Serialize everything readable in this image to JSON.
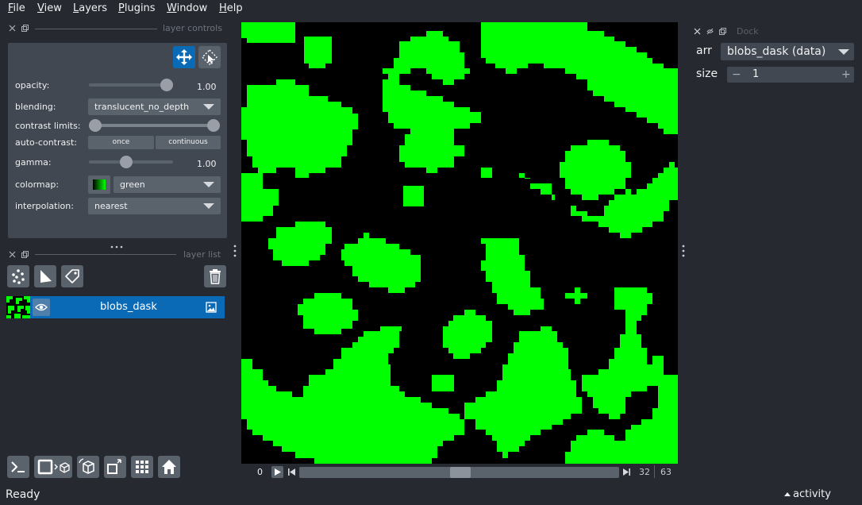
{
  "menubar": {
    "items": [
      {
        "label": "File",
        "mnemonic": "F",
        "rest": "ile"
      },
      {
        "label": "View",
        "mnemonic": "V",
        "rest": "iew"
      },
      {
        "label": "Layers",
        "mnemonic": "L",
        "rest": "ayers"
      },
      {
        "label": "Plugins",
        "mnemonic": "P",
        "rest": "lugins"
      },
      {
        "label": "Window",
        "mnemonic": "W",
        "rest": "indow"
      },
      {
        "label": "Help",
        "mnemonic": "H",
        "rest": "elp"
      }
    ]
  },
  "layer_controls": {
    "title": "layer controls",
    "opacity": {
      "label": "opacity:",
      "value": "1.00",
      "level": 1.0
    },
    "blending": {
      "label": "blending:",
      "value": "translucent_no_depth"
    },
    "contrast_limits": {
      "label": "contrast limits:",
      "min_level": 0.0,
      "max_level": 1.0
    },
    "auto_contrast": {
      "label": "auto-contrast:",
      "once": "once",
      "continuous": "continuous"
    },
    "gamma": {
      "label": "gamma:",
      "value": "1.00",
      "level": 0.5
    },
    "colormap": {
      "label": "colormap:",
      "value": "green"
    },
    "interpolation": {
      "label": "interpolation:",
      "value": "nearest"
    }
  },
  "layer_list": {
    "title": "layer list",
    "layers": [
      {
        "name": "blobs_dask",
        "visible": true,
        "selected": true
      }
    ]
  },
  "dims": {
    "left_value": "0",
    "current": "32",
    "total": "63",
    "position": 0.5
  },
  "dock": {
    "title": "Dock",
    "arr_label": "arr",
    "arr_value": "blobs_dask (data)",
    "size_label": "size",
    "size_value": "1",
    "minus": "−",
    "plus": "+"
  },
  "status": {
    "text": "Ready",
    "activity": "activity"
  },
  "colors": {
    "background": "#262930",
    "panel": "#414851",
    "accent": "#0a6ab5",
    "blob": "#00ff00"
  },
  "icons": {
    "pan_zoom": "move-arrows-icon",
    "transform": "transform-icon",
    "new_points": "points-icon",
    "new_shapes": "shapes-icon",
    "new_labels": "labels-tag-icon",
    "delete": "trash-icon",
    "visibility": "eye-icon",
    "layer_type": "image-icon",
    "console": "console-icon",
    "ndisplay": "square-3d-icon",
    "roll": "roll-icon",
    "transpose": "transpose-icon",
    "grid": "grid-icon",
    "home": "home-icon"
  }
}
